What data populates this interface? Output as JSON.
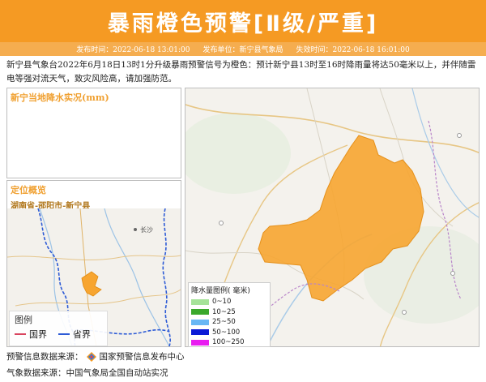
{
  "header": {
    "title": "暴雨橙色预警[Ⅱ级/严重]"
  },
  "meta": {
    "publish_time": "发布时间：2022-06-18 13:01:00",
    "publisher": "发布单位：新宁县气象局",
    "expire_time": "失效时间：2022-06-18 16:01:00"
  },
  "summary": "新宁县气象台2022年6月18日13时1分升级暴雨预警信号为橙色：预计新宁县13时至16时降雨量将达50毫米以上，并伴随雷电等强对流天气，致灾风险高，请加强防范。",
  "rain_panel": {
    "title": "新宁当地降水实况(mm)"
  },
  "locate_panel": {
    "title": "定位概览",
    "region": "湖南省-邵阳市-新宁县",
    "city_label": "长沙",
    "legend_title": "图例",
    "legend_national": "国界",
    "legend_provincial": "省界"
  },
  "rain_legend": {
    "title": "降水量图例( 毫米)",
    "items": [
      {
        "label": "0~10",
        "color": "#a6e39a"
      },
      {
        "label": "10~25",
        "color": "#3aa82c"
      },
      {
        "label": "25~50",
        "color": "#68b7f4"
      },
      {
        "label": "50~100",
        "color": "#0b1ad6"
      },
      {
        "label": "100~250",
        "color": "#e81cf0"
      }
    ]
  },
  "footer": {
    "warning_source_label": "预警信息数据来源：",
    "warning_source": "国家预警信息发布中心",
    "weather_source": "气象数据来源：中国气象局全国自动站实况"
  },
  "colors": {
    "accent": "#f59a23",
    "warning_area": "#f7a530",
    "national_border": "#d9455f",
    "provincial_border": "#2d5bd6"
  }
}
